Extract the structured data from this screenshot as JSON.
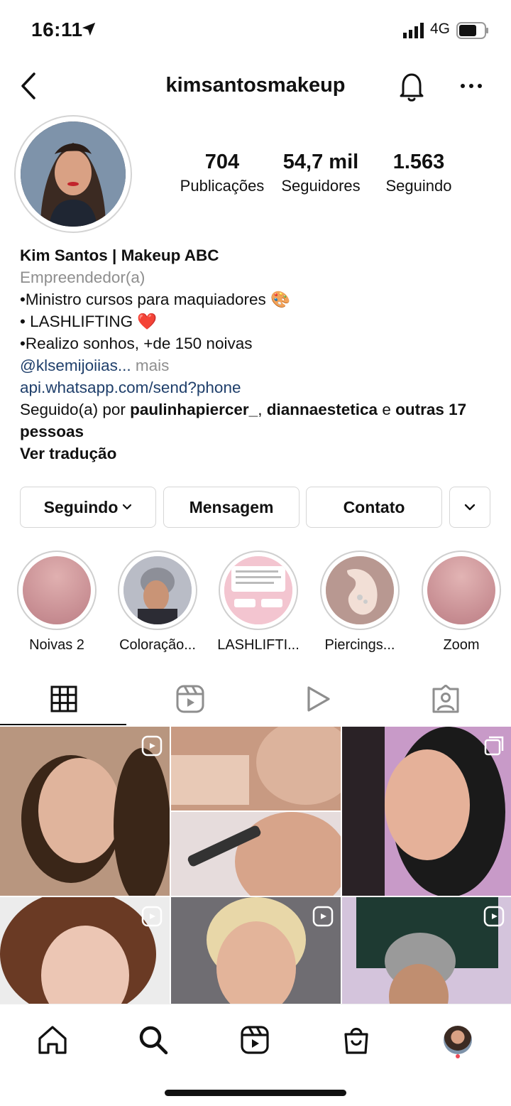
{
  "status_bar": {
    "time": "16:11",
    "network": "4G"
  },
  "header": {
    "username": "kimsantosmakeup"
  },
  "stats": [
    {
      "value": "704",
      "label": "Publicações"
    },
    {
      "value": "54,7 mil",
      "label": "Seguidores"
    },
    {
      "value": "1.563",
      "label": "Seguindo"
    }
  ],
  "bio": {
    "name": "Kim Santos | Makeup ABC",
    "category": "Empreendedor(a)",
    "lines": [
      "•Ministro cursos para maquiadores 🎨",
      "• LASHLIFTING ❤️",
      "•Realizo sonhos, +de 150 noivas"
    ],
    "mention": "@klsemijoiias...",
    "more": "mais",
    "link": "api.whatsapp.com/send?phone",
    "followed_prefix": "Seguido(a) por",
    "followed_user1": "paulinhapiercer_",
    "followed_sep": ",",
    "followed_user2": "diannaestetica",
    "followed_and": "e",
    "followed_others": "outras 17 pessoas",
    "translate": "Ver tradução"
  },
  "actions": {
    "following": "Seguindo",
    "message": "Mensagem",
    "contact": "Contato"
  },
  "highlights": [
    {
      "label": "Noivas 2"
    },
    {
      "label": "Coloração..."
    },
    {
      "label": "LASHLIFTI..."
    },
    {
      "label": "Piercings..."
    },
    {
      "label": "Zoom"
    }
  ],
  "tabs": [
    "grid-icon",
    "reels-icon",
    "video-icon",
    "tagged-icon"
  ],
  "colors": {
    "link": "#1f3f6b",
    "muted": "#8e8e8e",
    "notification_dot": "#ed4956"
  }
}
